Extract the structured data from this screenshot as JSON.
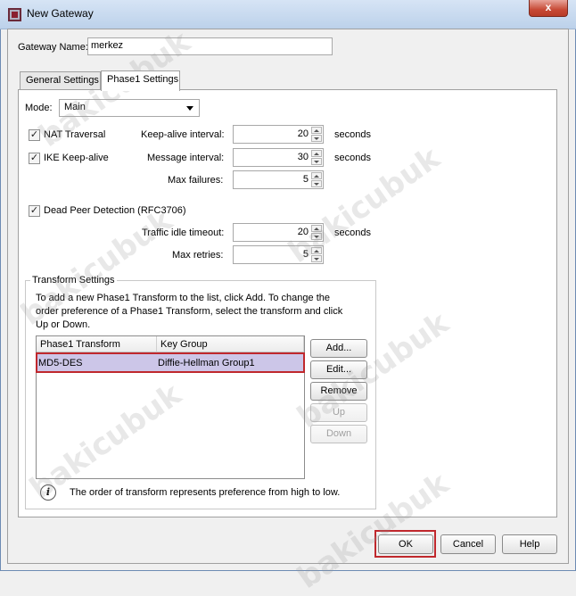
{
  "window": {
    "title": "New Gateway",
    "close_glyph": "x"
  },
  "gateway_name": {
    "label": "Gateway Name:",
    "value": "merkez"
  },
  "tabs": [
    {
      "label": "General Settings",
      "active": false
    },
    {
      "label": "Phase1 Settings",
      "active": true
    }
  ],
  "mode": {
    "label": "Mode:",
    "selected": "Main"
  },
  "nat_traversal": {
    "label": "NAT Traversal",
    "checked": true
  },
  "ike_keepalive": {
    "label": "IKE Keep-alive",
    "checked": true
  },
  "dpd": {
    "label": "Dead Peer Detection (RFC3706)",
    "checked": true
  },
  "check_glyph": "✓",
  "keepalive_interval": {
    "label": "Keep-alive interval:",
    "value": "20",
    "unit": "seconds"
  },
  "message_interval": {
    "label": "Message interval:",
    "value": "30",
    "unit": "seconds"
  },
  "max_failures": {
    "label": "Max failures:",
    "value": "5"
  },
  "traffic_idle_timeout": {
    "label": "Traffic idle timeout:",
    "value": "20",
    "unit": "seconds"
  },
  "max_retries": {
    "label": "Max retries:",
    "value": "5"
  },
  "transform_settings": {
    "title": "Transform Settings",
    "instructions": [
      "To add a new Phase1 Transform to the list, click Add. To change the",
      "order preference of a Phase1 Transform, select the transform and click",
      "Up or Down."
    ],
    "columns": [
      "Phase1 Transform",
      "Key Group"
    ],
    "rows": [
      {
        "transform": "MD5-DES",
        "key_group": "Diffie-Hellman Group1",
        "selected": true
      }
    ],
    "buttons": {
      "add": "Add...",
      "edit": "Edit...",
      "remove": "Remove",
      "up": "Up",
      "down": "Down"
    },
    "info_text": "The order of transform represents preference from high to low.",
    "info_glyph": "i"
  },
  "footer_buttons": {
    "ok": "OK",
    "cancel": "Cancel",
    "help": "Help"
  },
  "watermark_text": "bakicubuk",
  "colors": {
    "highlight": "#c0282d",
    "selection": "#ccc6e8"
  }
}
